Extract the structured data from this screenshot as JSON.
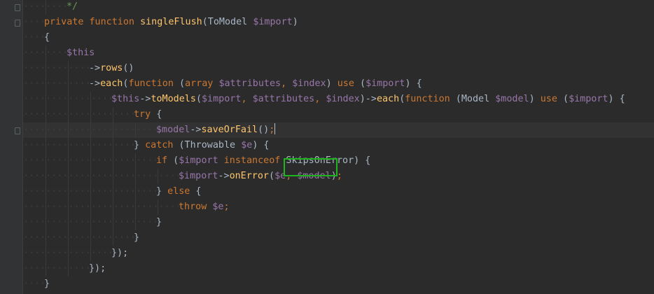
{
  "editor": {
    "lines": [
      {
        "indent": 2,
        "tokens": [
          {
            "t": "*/",
            "c": "cm"
          }
        ]
      },
      {
        "indent": 1,
        "tokens": [
          {
            "t": "private",
            "c": "kw"
          },
          {
            "t": " ",
            "c": "pl"
          },
          {
            "t": "function",
            "c": "kw"
          },
          {
            "t": " ",
            "c": "pl"
          },
          {
            "t": "singleFlush",
            "c": "fn"
          },
          {
            "t": "(ToModel ",
            "c": "pl"
          },
          {
            "t": "$import",
            "c": "var"
          },
          {
            "t": ")",
            "c": "pl"
          }
        ]
      },
      {
        "indent": 1,
        "tokens": [
          {
            "t": "{",
            "c": "pl"
          }
        ]
      },
      {
        "indent": 2,
        "tokens": [
          {
            "t": "$this",
            "c": "var"
          }
        ]
      },
      {
        "indent": 3,
        "tokens": [
          {
            "t": "->",
            "c": "pl"
          },
          {
            "t": "rows",
            "c": "fn"
          },
          {
            "t": "()",
            "c": "pl"
          }
        ]
      },
      {
        "indent": 3,
        "tokens": [
          {
            "t": "->",
            "c": "pl"
          },
          {
            "t": "each",
            "c": "fn"
          },
          {
            "t": "(",
            "c": "pl"
          },
          {
            "t": "function",
            "c": "kw"
          },
          {
            "t": " (",
            "c": "pl"
          },
          {
            "t": "array",
            "c": "kw"
          },
          {
            "t": " ",
            "c": "pl"
          },
          {
            "t": "$attributes",
            "c": "var"
          },
          {
            "t": ", ",
            "c": "kw"
          },
          {
            "t": "$index",
            "c": "var"
          },
          {
            "t": ") ",
            "c": "pl"
          },
          {
            "t": "use",
            "c": "kw"
          },
          {
            "t": " (",
            "c": "pl"
          },
          {
            "t": "$import",
            "c": "var"
          },
          {
            "t": ") {",
            "c": "pl"
          }
        ]
      },
      {
        "indent": 4,
        "tokens": [
          {
            "t": "$this",
            "c": "var"
          },
          {
            "t": "->",
            "c": "pl"
          },
          {
            "t": "toModels",
            "c": "fn"
          },
          {
            "t": "(",
            "c": "pl"
          },
          {
            "t": "$import",
            "c": "var"
          },
          {
            "t": ", ",
            "c": "kw"
          },
          {
            "t": "$attributes",
            "c": "var"
          },
          {
            "t": ", ",
            "c": "kw"
          },
          {
            "t": "$index",
            "c": "var"
          },
          {
            "t": ")->",
            "c": "pl"
          },
          {
            "t": "each",
            "c": "fn"
          },
          {
            "t": "(",
            "c": "pl"
          },
          {
            "t": "function",
            "c": "kw"
          },
          {
            "t": " (Model ",
            "c": "pl"
          },
          {
            "t": "$model",
            "c": "var"
          },
          {
            "t": ") ",
            "c": "pl"
          },
          {
            "t": "use",
            "c": "kw"
          },
          {
            "t": " (",
            "c": "pl"
          },
          {
            "t": "$import",
            "c": "var"
          },
          {
            "t": ") {",
            "c": "pl"
          }
        ]
      },
      {
        "indent": 5,
        "tokens": [
          {
            "t": "try",
            "c": "kw"
          },
          {
            "t": " {",
            "c": "pl"
          }
        ]
      },
      {
        "indent": 6,
        "caret": true,
        "tokens": [
          {
            "t": "$model",
            "c": "var"
          },
          {
            "t": "->",
            "c": "pl"
          },
          {
            "t": "saveOrFail",
            "c": "fn"
          },
          {
            "t": "()",
            "c": "pl"
          },
          {
            "t": ";",
            "c": "kw"
          },
          {
            "t": "|",
            "c": "caret"
          }
        ]
      },
      {
        "indent": 5,
        "tokens": [
          {
            "t": "} ",
            "c": "pl"
          },
          {
            "t": "catch",
            "c": "kw"
          },
          {
            "t": " (Throwable ",
            "c": "pl"
          },
          {
            "t": "$e",
            "c": "var"
          },
          {
            "t": ") {",
            "c": "pl"
          }
        ]
      },
      {
        "indent": 6,
        "tokens": [
          {
            "t": "if",
            "c": "kw"
          },
          {
            "t": " (",
            "c": "pl"
          },
          {
            "t": "$import",
            "c": "var"
          },
          {
            "t": " ",
            "c": "pl"
          },
          {
            "t": "instanceof",
            "c": "kw"
          },
          {
            "t": " SkipsOnError) {",
            "c": "pl"
          }
        ]
      },
      {
        "indent": 7,
        "tokens": [
          {
            "t": "$import",
            "c": "var"
          },
          {
            "t": "->",
            "c": "pl"
          },
          {
            "t": "onError",
            "c": "fn"
          },
          {
            "t": "(",
            "c": "pl"
          },
          {
            "t": "$e",
            "c": "var"
          },
          {
            "t": ", ",
            "c": "kw"
          },
          {
            "t": "$model",
            "c": "var"
          },
          {
            "t": ")",
            "c": "pl"
          },
          {
            "t": ";",
            "c": "kw"
          }
        ]
      },
      {
        "indent": 6,
        "tokens": [
          {
            "t": "} ",
            "c": "pl"
          },
          {
            "t": "else",
            "c": "kw"
          },
          {
            "t": " {",
            "c": "pl"
          }
        ]
      },
      {
        "indent": 7,
        "tokens": [
          {
            "t": "throw",
            "c": "kw"
          },
          {
            "t": " ",
            "c": "pl"
          },
          {
            "t": "$e",
            "c": "var"
          },
          {
            "t": ";",
            "c": "kw"
          }
        ]
      },
      {
        "indent": 6,
        "tokens": [
          {
            "t": "}",
            "c": "pl"
          }
        ]
      },
      {
        "indent": 5,
        "tokens": [
          {
            "t": "}",
            "c": "pl"
          }
        ]
      },
      {
        "indent": 4,
        "tokens": [
          {
            "t": "});",
            "c": "pl"
          }
        ]
      },
      {
        "indent": 3,
        "tokens": [
          {
            "t": "});",
            "c": "pl"
          }
        ]
      },
      {
        "indent": 1,
        "tokens": [
          {
            "t": "}",
            "c": "pl"
          }
        ]
      }
    ]
  },
  "colors": {
    "background": "#2b2b2b",
    "keyword": "#cc7832",
    "function": "#ffc66d",
    "variable": "#9876aa",
    "plain": "#a9b7c6",
    "highlight_box": "#1fb51f"
  },
  "highlight": {
    "label": "$e, $model highlighted argument region"
  }
}
